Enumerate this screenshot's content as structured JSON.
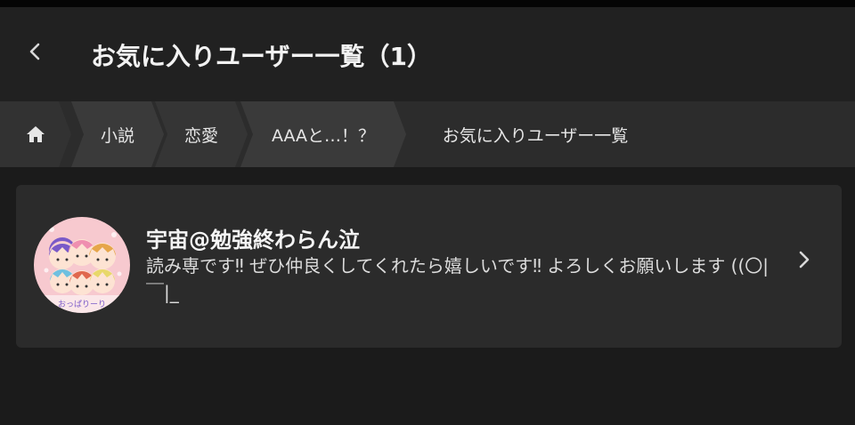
{
  "header": {
    "title": "お気に入りユーザー一覧（1）",
    "back_icon": "chevron-left-icon"
  },
  "breadcrumb": {
    "home_icon": "home-icon",
    "items": [
      {
        "label": "小説"
      },
      {
        "label": "恋愛"
      },
      {
        "label": "AAAと…！？"
      },
      {
        "label": "お気に入りユーザー一覧"
      }
    ]
  },
  "users": [
    {
      "name": "宇宙@勉強終わらん泣",
      "bio": "読み専です‼ ぜひ仲良くしてくれたら嬉しいです‼ よろしくお願いします ((〇|￣|_",
      "avatar_text": "おっぱりーり"
    }
  ],
  "colors": {
    "background": "#1b1b1b",
    "header": "#212121",
    "breadcrumb": "#2c2c2c",
    "card": "#2b2b2b",
    "text": "#e8e8e8"
  }
}
